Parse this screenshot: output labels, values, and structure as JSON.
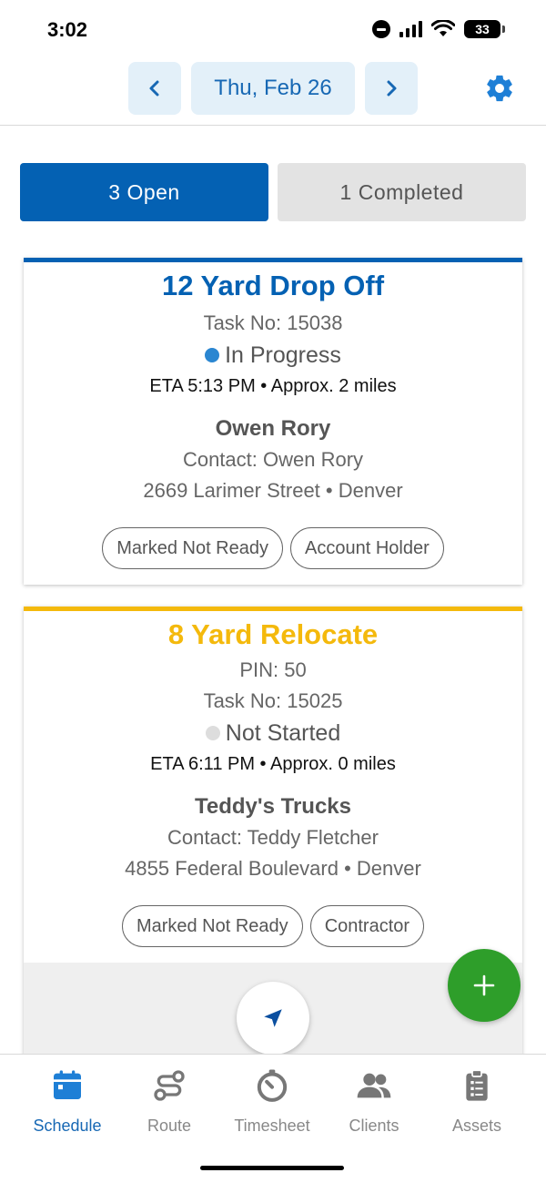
{
  "status_bar": {
    "time": "3:02",
    "battery": "33"
  },
  "header": {
    "date": "Thu, Feb 26"
  },
  "tabs": {
    "open": "3 Open",
    "completed": "1 Completed"
  },
  "tasks": [
    {
      "title": "12 Yard Drop Off",
      "task_no": "Task No: 15038",
      "status": "In Progress",
      "eta": "ETA 5:13 PM • Approx. 2 miles",
      "client": "Owen Rory",
      "contact": "Contact: Owen Rory",
      "address": "2669 Larimer Street • Denver",
      "tags": [
        "Marked Not Ready",
        "Account Holder"
      ],
      "status_color": "#2a86d1",
      "accent": "#0461b3"
    },
    {
      "title": "8 Yard Relocate",
      "pin": "PIN: 50",
      "task_no": "Task No: 15025",
      "status": "Not Started",
      "eta": "ETA 6:11 PM • Approx. 0 miles",
      "client": "Teddy's Trucks",
      "contact": "Contact: Teddy Fletcher",
      "address": "4855 Federal Boulevard • Denver",
      "tags": [
        "Marked Not Ready",
        "Contractor"
      ],
      "status_color": "#dddddd",
      "accent": "#f4b90c"
    }
  ],
  "bottom_nav": [
    {
      "label": "Schedule",
      "icon": "calendar-icon",
      "active": true
    },
    {
      "label": "Route",
      "icon": "route-icon"
    },
    {
      "label": "Timesheet",
      "icon": "timer-icon"
    },
    {
      "label": "Clients",
      "icon": "people-icon"
    },
    {
      "label": "Assets",
      "icon": "clipboard-icon"
    }
  ],
  "colors": {
    "primary": "#0461b3",
    "accent_yellow": "#f4b90c",
    "fab_green": "#2e9e2a"
  }
}
